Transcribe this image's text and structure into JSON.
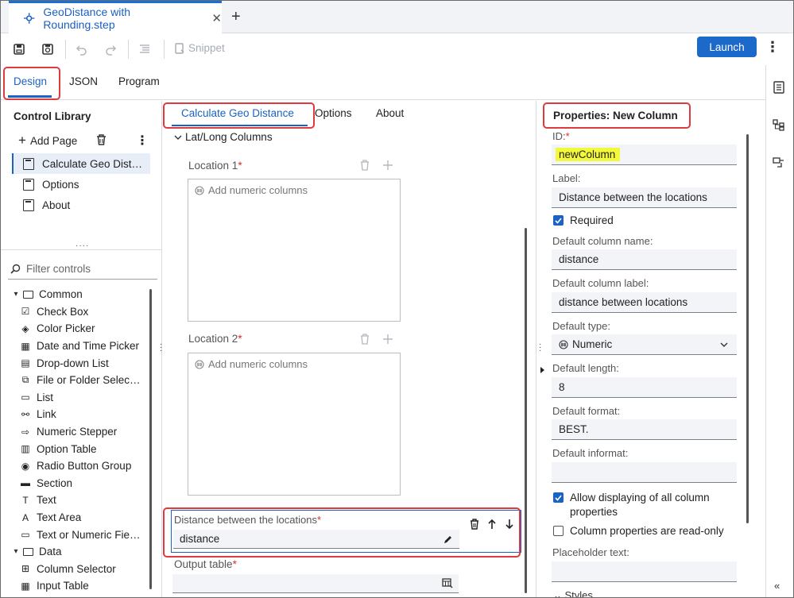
{
  "file_tab": {
    "name": "GeoDistance with Rounding.step",
    "close": "✕",
    "new_tab": "+"
  },
  "toolbar": {
    "snippet_label": "Snippet",
    "launch_label": "Launch"
  },
  "mode_tabs": [
    "Design",
    "JSON",
    "Program"
  ],
  "control_library": {
    "title": "Control Library",
    "add_page_label": "Add Page",
    "pages": [
      "Calculate Geo Dist…",
      "Options",
      "About"
    ],
    "filter_placeholder": "Filter controls",
    "tree": [
      {
        "type": "folder",
        "label": "Common"
      },
      {
        "type": "item",
        "label": "Check Box",
        "icon": "☑"
      },
      {
        "type": "item",
        "label": "Color Picker",
        "icon": "◈"
      },
      {
        "type": "item",
        "label": "Date and Time Picker",
        "icon": "▦"
      },
      {
        "type": "item",
        "label": "Drop-down List",
        "icon": "▤"
      },
      {
        "type": "item",
        "label": "File or Folder Selec…",
        "icon": "⧉"
      },
      {
        "type": "item",
        "label": "List",
        "icon": "▭"
      },
      {
        "type": "item",
        "label": "Link",
        "icon": "⚯"
      },
      {
        "type": "item",
        "label": "Numeric Stepper",
        "icon": "⇨"
      },
      {
        "type": "item",
        "label": "Option Table",
        "icon": "▥"
      },
      {
        "type": "item",
        "label": "Radio Button Group",
        "icon": "◉"
      },
      {
        "type": "item",
        "label": "Section",
        "icon": "▬"
      },
      {
        "type": "item",
        "label": "Text",
        "icon": "T"
      },
      {
        "type": "item",
        "label": "Text Area",
        "icon": "A"
      },
      {
        "type": "item",
        "label": "Text or Numeric Fie…",
        "icon": "▭"
      },
      {
        "type": "folder",
        "label": "Data"
      },
      {
        "type": "item",
        "label": "Column Selector",
        "icon": "⊞"
      },
      {
        "type": "item",
        "label": "Input Table",
        "icon": "▦"
      }
    ]
  },
  "page_tabs": [
    "Calculate Geo Distance",
    "Options",
    "About"
  ],
  "canvas": {
    "section": "Lat/Long Columns",
    "location1_label": "Location  1",
    "location2_label": "Location 2",
    "required_mark": "*",
    "add_columns_hint": "Add numeric columns",
    "selected_field": {
      "label": "Distance between the locations",
      "value": "distance"
    },
    "output_label": "Output table"
  },
  "properties": {
    "title": "Properties: New Column",
    "id_label": "ID:",
    "id_value": "newColumn",
    "label_label": "Label:",
    "label_value": "Distance between the locations",
    "required_label": "Required",
    "default_column_name_label": "Default column name:",
    "default_column_name_value": "distance",
    "default_column_label_label": "Default column label:",
    "default_column_label_value": "distance between locations",
    "default_type_label": "Default type:",
    "default_type_value": "Numeric",
    "default_length_label": "Default length:",
    "default_length_value": "8",
    "default_format_label": "Default format:",
    "default_format_value": "BEST.",
    "default_informat_label": "Default informat:",
    "default_informat_value": "",
    "allow_display_line1": "Allow displaying of all column",
    "allow_display_line2": "properties",
    "readonly_label": "Column properties are read-only",
    "placeholder_label": "Placeholder text:",
    "styles_label": "Styles"
  },
  "colors": {
    "accent": "#1a62c4",
    "launch": "#1b69c9",
    "annotation": "#e0393e",
    "highlight": "#f2f83a"
  }
}
